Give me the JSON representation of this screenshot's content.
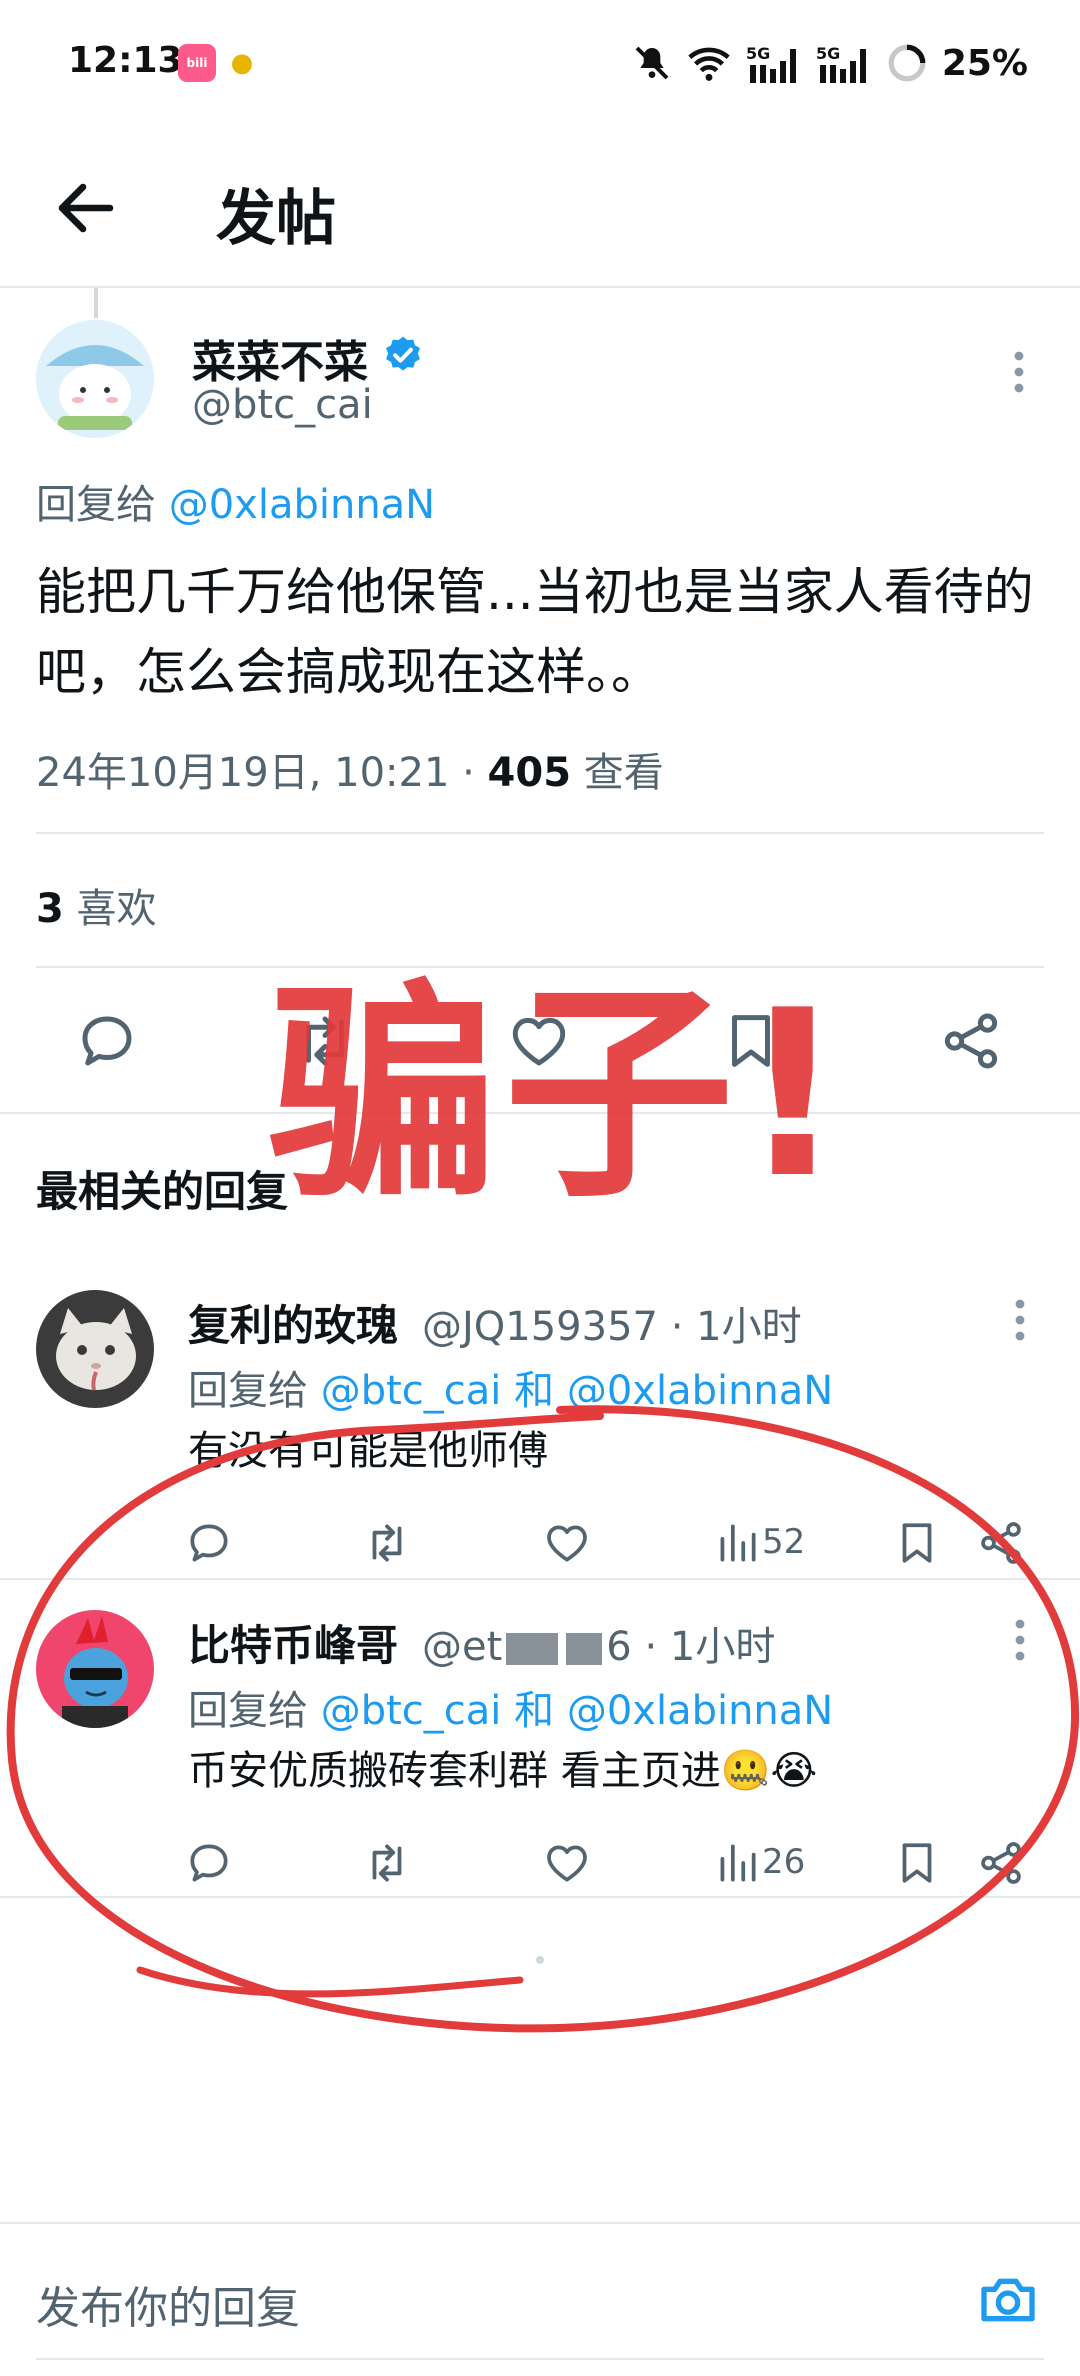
{
  "status_bar": {
    "time": "12:13",
    "battery": "25%",
    "network": "5G"
  },
  "header": {
    "title": "发帖"
  },
  "post": {
    "author_name": "菜菜不菜",
    "author_handle": "@btc_cai",
    "reply_to_label": "回复给",
    "reply_to_handle": "@0xlabinnaN",
    "text": "能把几千万给他保管...当初也是当家人看待的吧，怎么会搞成现在这样。。",
    "timestamp": "24年10月19日, 10:21 · ",
    "views_count": "405",
    "views_label": " 查看",
    "likes_count": "3",
    "likes_label": " 喜欢"
  },
  "replies_section": {
    "title": "最相关的回复"
  },
  "replies": [
    {
      "name": "复利的玫瑰",
      "handle": "@JQ159357 · 1小时",
      "reply_label": "回复给",
      "reply_to": "@btc_cai 和 @0xlabinnaN",
      "text": "有没有可能是他师傅",
      "views": "52"
    },
    {
      "name": "比特币峰哥",
      "handle_prefix": "@et",
      "handle_suffix": "6 · 1小时",
      "reply_label": "回复给",
      "reply_to": "@btc_cai 和 @0xlabinnaN",
      "text": "币安优质搬砖套利群 看主页进🤐😭",
      "views": "26"
    }
  ],
  "compose": {
    "placeholder": "发布你的回复"
  },
  "annotation": {
    "text": "骗子!",
    "color": "#e23b3b"
  },
  "colors": {
    "link": "#1d9bf0",
    "secondary_text": "#536471",
    "primary_text": "#0f1419",
    "divider": "#e6e9eb"
  }
}
